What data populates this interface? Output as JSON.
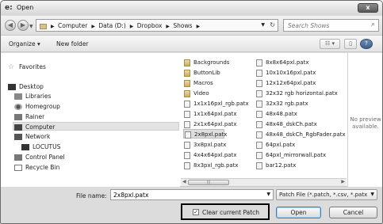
{
  "window": {
    "title": "Open",
    "app_icon_text": "e:",
    "close_label": "x"
  },
  "address": {
    "crumbs": [
      "Computer",
      "Data (D:)",
      "Dropbox",
      "Shows"
    ],
    "search_placeholder": "Search Shows"
  },
  "toolbar": {
    "organize": "Organize ▾",
    "new_folder": "New folder"
  },
  "nav": {
    "favorites": "Favorites",
    "desktop": "Desktop",
    "libraries": "Libraries",
    "homegroup": "Homegroup",
    "rainer": "Rainer",
    "computer": "Computer",
    "network": "Network",
    "locutus": "LOCUTUS",
    "control_panel": "Control Panel",
    "recycle_bin": "Recycle Bin"
  },
  "files_col1": [
    {
      "name": "Backgrounds",
      "type": "folder"
    },
    {
      "name": "ButtonLib",
      "type": "folder"
    },
    {
      "name": "Macros",
      "type": "folder"
    },
    {
      "name": "Video",
      "type": "folder"
    },
    {
      "name": "1x1x16pxl_rgb.patx",
      "type": "file"
    },
    {
      "name": "1x1x64pxl.patx",
      "type": "file"
    },
    {
      "name": "2x1x64pxl.patx",
      "type": "file"
    },
    {
      "name": "2x8pxl.patx",
      "type": "file",
      "selected": true
    },
    {
      "name": "3x8pxl.patx",
      "type": "file"
    },
    {
      "name": "4x4x64pxl.patx",
      "type": "file"
    },
    {
      "name": "8x3pxl_rgb.patx",
      "type": "file"
    }
  ],
  "files_col2": [
    {
      "name": "8x8x64pxl.patx",
      "type": "file"
    },
    {
      "name": "10x10x16pxl.patx",
      "type": "file"
    },
    {
      "name": "12x12x64pxl.patx",
      "type": "file"
    },
    {
      "name": "32x32 rgb horizontal.patx",
      "type": "file"
    },
    {
      "name": "32x32 rgb.patx",
      "type": "file"
    },
    {
      "name": "48x48.patx",
      "type": "file"
    },
    {
      "name": "48x48_dskCh.patx",
      "type": "file"
    },
    {
      "name": "48x48_dskCh_RgbFader.patx",
      "type": "file"
    },
    {
      "name": "64pxl.patx",
      "type": "file"
    },
    {
      "name": "64pxl_mirrorwall.patx",
      "type": "file"
    },
    {
      "name": "bar12.patx",
      "type": "file"
    }
  ],
  "preview": {
    "line1": "No preview",
    "line2": "available."
  },
  "bottom": {
    "file_name_label": "File name:",
    "file_name_value": "2x8pxl.patx",
    "file_type": "Patch File (*.patch, *.csv, *.patx",
    "clear_patch_label": "Clear current Patch",
    "clear_patch_checked": true,
    "open_label": "Open",
    "cancel_label": "Cancel"
  }
}
